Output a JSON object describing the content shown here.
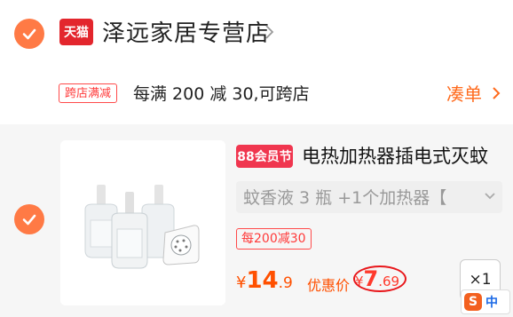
{
  "store": {
    "badge": "天猫",
    "name": "泽远家居专营店"
  },
  "promo": {
    "tag": "跨店满减",
    "text": "每满 200 减 30,可跨店",
    "link": "凑单"
  },
  "item": {
    "badge": "88会员节",
    "title": "电热加热器插电式灭蚊",
    "sku": "蚊香液 3 瓶 +1个加热器【",
    "discount_tag": "每200减30",
    "price": {
      "currency": "¥",
      "integer": "14",
      "decimal": ".9"
    },
    "coupon_label": "优惠价",
    "coupon_price": {
      "currency": "¥",
      "integer": "7",
      "decimal": ".69"
    },
    "quantity": "×1"
  },
  "ime": {
    "logo": "S",
    "mode": "中"
  },
  "colors": {
    "accent": "#ff7a45",
    "price": "#ff5000",
    "tag_red": "#ff3a3a",
    "tmall_red": "#e3262d"
  }
}
